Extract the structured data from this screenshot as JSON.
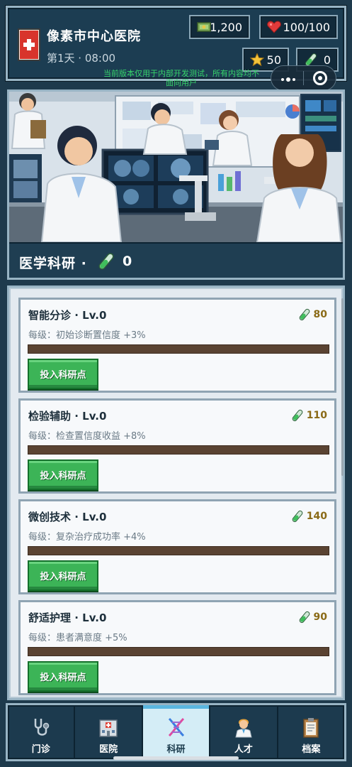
{
  "header": {
    "hospital_name": "像素市中心医院",
    "day_time": "第1天 · 08:00",
    "money": "1,200",
    "health": "100/100",
    "stars": "50",
    "research_points": "0",
    "notice": "当前版本仅用于内部开发测试，所有内容均不面向用户",
    "icons": {
      "logo": "hospital-cross-icon",
      "money": "cash-icon",
      "health": "heart-icon",
      "stars": "star-icon",
      "research": "test-tube-icon"
    }
  },
  "capsule": {
    "more": "more-dots-icon",
    "close": "close-target-icon"
  },
  "banner": {
    "title": "医学科研 ·",
    "points": "0",
    "scene": "research-lab-illustration"
  },
  "research_items": [
    {
      "name": "智能分诊 · Lv.0",
      "cost": "80",
      "desc": "每级：初始诊断置信度 +3%",
      "progress": 0,
      "button": "投入科研点"
    },
    {
      "name": "检验辅助 · Lv.0",
      "cost": "110",
      "desc": "每级：检查置信度收益 +8%",
      "progress": 0,
      "button": "投入科研点"
    },
    {
      "name": "微创技术 · Lv.0",
      "cost": "140",
      "desc": "每级：复杂治疗成功率 +4%",
      "progress": 0,
      "button": "投入科研点"
    },
    {
      "name": "舒适护理 · Lv.0",
      "cost": "90",
      "desc": "每级：患者满意度 +5%",
      "progress": 0,
      "button": "投入科研点"
    }
  ],
  "nav": [
    {
      "label": "门诊",
      "icon": "stethoscope-icon",
      "active": false
    },
    {
      "label": "医院",
      "icon": "hospital-building-icon",
      "active": false
    },
    {
      "label": "科研",
      "icon": "dna-icon",
      "active": true
    },
    {
      "label": "人才",
      "icon": "doctor-icon",
      "active": false
    },
    {
      "label": "档案",
      "icon": "clipboard-icon",
      "active": false
    }
  ],
  "colors": {
    "background": "#1e3a4c",
    "panel": "#1c3d52",
    "border": "#98b4c4",
    "button_green": "#3cb457",
    "progress_track": "#5a4332",
    "cost_gold": "#8a6a16",
    "notice_green": "#36d36a",
    "active_tab": "#d4edf6"
  }
}
